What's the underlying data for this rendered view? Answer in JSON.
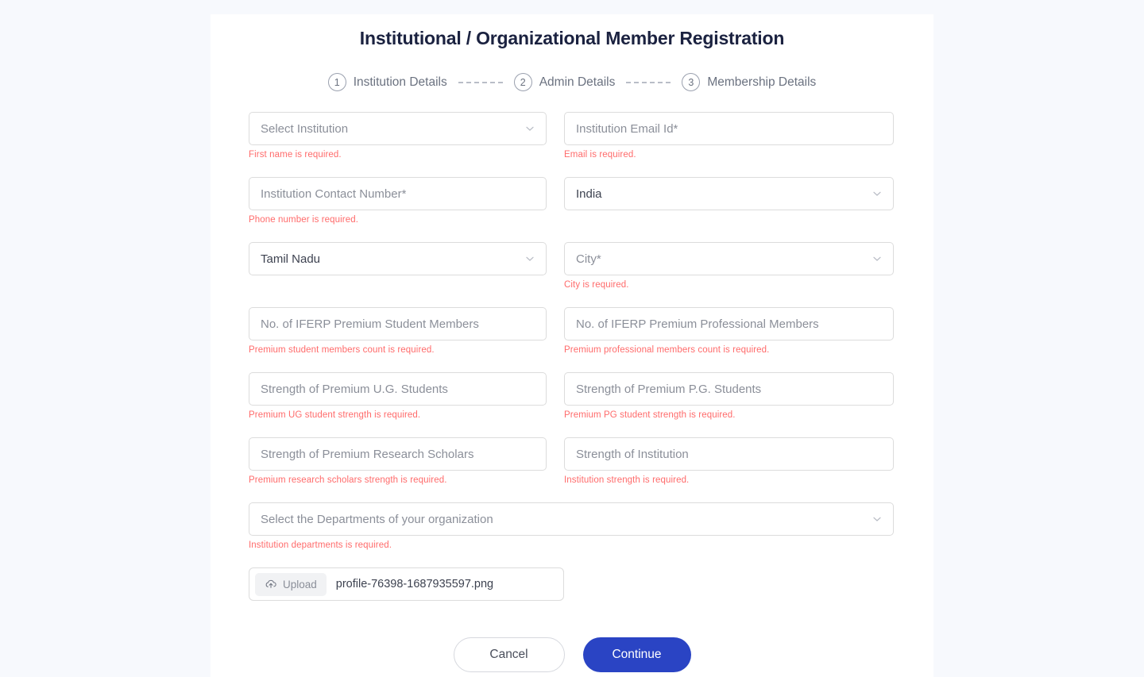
{
  "page": {
    "title": "Institutional / Organizational Member Registration",
    "background_color": "#f7f9fd",
    "card_color": "#ffffff",
    "accent_color": "#2a44c4",
    "error_color": "#ff6b6b"
  },
  "stepper": {
    "steps": [
      {
        "number": "1",
        "label": "Institution Details"
      },
      {
        "number": "2",
        "label": "Admin Details"
      },
      {
        "number": "3",
        "label": "Membership Details"
      }
    ]
  },
  "form": {
    "rows": [
      {
        "left": {
          "name": "institution-select",
          "type": "select",
          "value": "Select Institution",
          "filled": false,
          "error": "First name is required."
        },
        "right": {
          "name": "institution-email-input",
          "type": "text",
          "value": "Institution Email Id*",
          "filled": false,
          "error": "Email is required."
        }
      },
      {
        "left": {
          "name": "institution-contact-input",
          "type": "text",
          "value": "Institution Contact Number*",
          "filled": false,
          "error": "Phone number is required."
        },
        "right": {
          "name": "country-select",
          "type": "select",
          "value": "India",
          "filled": true,
          "error": ""
        }
      },
      {
        "left": {
          "name": "state-select",
          "type": "select",
          "value": "Tamil Nadu",
          "filled": true,
          "error": ""
        },
        "right": {
          "name": "city-select",
          "type": "select",
          "value": "City*",
          "filled": false,
          "error": "City is required."
        }
      },
      {
        "left": {
          "name": "premium-student-members-input",
          "type": "text",
          "value": "No. of IFERP Premium Student Members",
          "filled": false,
          "error": "Premium student members count is required."
        },
        "right": {
          "name": "premium-professional-members-input",
          "type": "text",
          "value": "No. of IFERP Premium Professional Members",
          "filled": false,
          "error": "Premium professional members count is required."
        }
      },
      {
        "left": {
          "name": "premium-ug-strength-input",
          "type": "text",
          "value": "Strength of Premium U.G. Students",
          "filled": false,
          "error": "Premium UG student strength is required."
        },
        "right": {
          "name": "premium-pg-strength-input",
          "type": "text",
          "value": "Strength of Premium P.G. Students",
          "filled": false,
          "error": "Premium PG student strength is required."
        }
      },
      {
        "left": {
          "name": "premium-research-scholars-input",
          "type": "text",
          "value": "Strength of Premium Research Scholars",
          "filled": false,
          "error": "Premium research scholars strength is required."
        },
        "right": {
          "name": "institution-strength-input",
          "type": "text",
          "value": "Strength of Institution",
          "filled": false,
          "error": "Institution strength is required."
        }
      }
    ],
    "departments": {
      "name": "departments-select",
      "type": "select",
      "value": "Select the Departments of your organization",
      "filled": false,
      "error": "Institution departments is required."
    },
    "upload": {
      "button_label": "Upload",
      "filename": "profile-76398-1687935597.png",
      "icon": "cloud-upload-icon"
    }
  },
  "footer": {
    "cancel_label": "Cancel",
    "continue_label": "Continue"
  }
}
